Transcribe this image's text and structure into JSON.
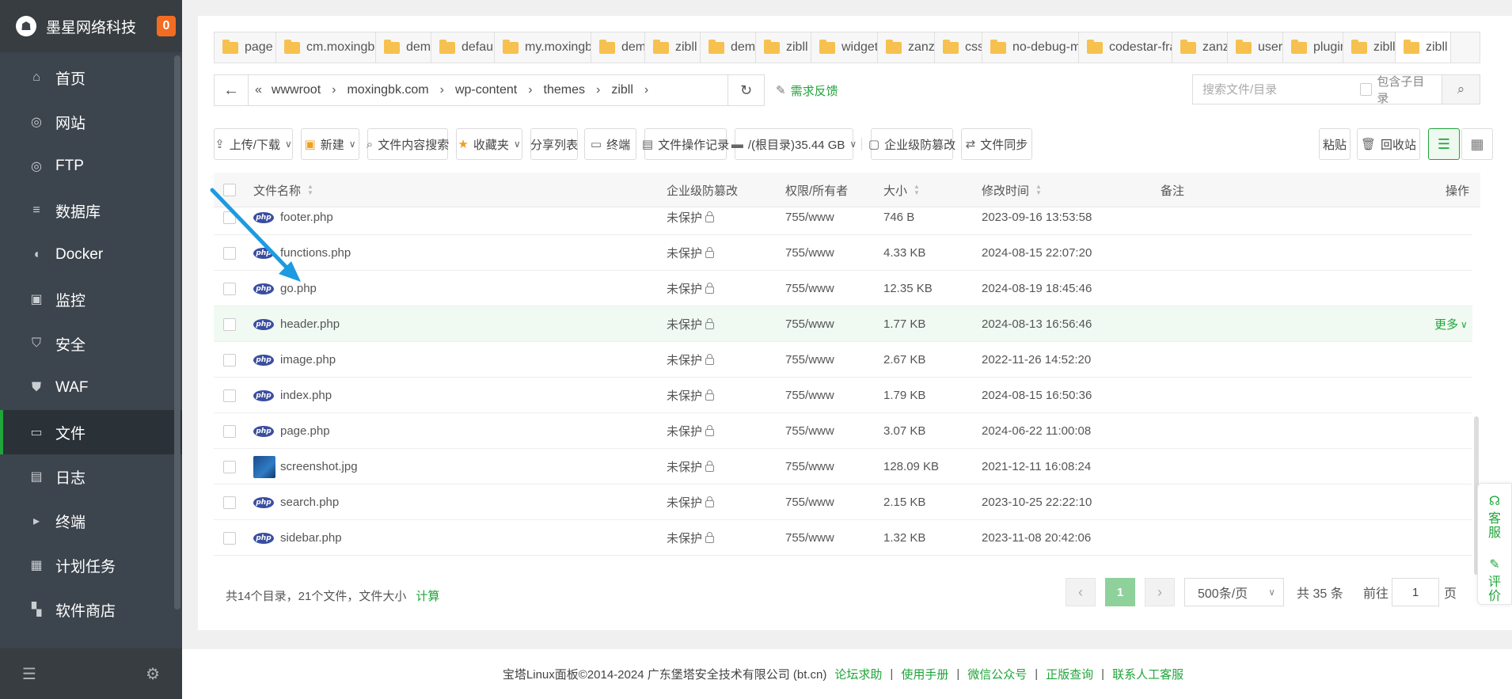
{
  "sidebar": {
    "title": "墨星网络科技",
    "badge": "0",
    "items": [
      {
        "label": "首页",
        "icon": "home-icon"
      },
      {
        "label": "网站",
        "icon": "globe-icon"
      },
      {
        "label": "FTP",
        "icon": "ftp-icon"
      },
      {
        "label": "数据库",
        "icon": "database-icon"
      },
      {
        "label": "Docker",
        "icon": "docker-icon"
      },
      {
        "label": "监控",
        "icon": "monitor-icon"
      },
      {
        "label": "安全",
        "icon": "shield-icon"
      },
      {
        "label": "WAF",
        "icon": "waf-icon"
      },
      {
        "label": "文件",
        "icon": "folder-icon"
      },
      {
        "label": "日志",
        "icon": "log-icon"
      },
      {
        "label": "终端",
        "icon": "terminal-icon"
      },
      {
        "label": "计划任务",
        "icon": "calendar-icon"
      },
      {
        "label": "软件商店",
        "icon": "apps-icon"
      }
    ],
    "active_item": "文件"
  },
  "tabs": [
    "page",
    "cm.moxingbk",
    "demo",
    "default",
    "my.moxingbk",
    "demo",
    "zibll",
    "demo",
    "zibll",
    "widget",
    "zanzhu",
    "css",
    "no-debug-m",
    "codestar-fra",
    "zanzh",
    "user",
    "plugin",
    "zibll",
    "zibll"
  ],
  "breadcrumb": [
    "wwwroot",
    "moxingbk.com",
    "wp-content",
    "themes",
    "zibll"
  ],
  "feedback_label": "需求反馈",
  "search": {
    "placeholder": "搜索文件/目录",
    "subdir_label": "包含子目录"
  },
  "toolbar": {
    "upload": "上传/下载",
    "new": "新建",
    "content_search": "文件内容搜索",
    "favorites": "收藏夹",
    "share_list": "分享列表",
    "terminal": "终端",
    "op_log": "文件操作记录",
    "disk": "/(根目录)35.44 GB",
    "tamper": "企业级防篡改",
    "sync": "文件同步",
    "paste": "粘贴",
    "recycle": "回收站"
  },
  "table": {
    "headers": {
      "name": "文件名称",
      "tamper": "企业级防篡改",
      "perm": "权限/所有者",
      "size": "大小",
      "mtime": "修改时间",
      "note": "备注",
      "ops": "操作"
    },
    "rows": [
      {
        "name": "footer.php",
        "type": "php",
        "tamper": "未保护",
        "perm": "755/www",
        "size": "746 B",
        "mtime": "2023-09-16 13:53:58",
        "ops": ""
      },
      {
        "name": "functions.php",
        "type": "php",
        "tamper": "未保护",
        "perm": "755/www",
        "size": "4.33 KB",
        "mtime": "2024-08-15 22:07:20",
        "ops": ""
      },
      {
        "name": "go.php",
        "type": "php",
        "tamper": "未保护",
        "perm": "755/www",
        "size": "12.35 KB",
        "mtime": "2024-08-19 18:45:46",
        "ops": ""
      },
      {
        "name": "header.php",
        "type": "php",
        "tamper": "未保护",
        "perm": "755/www",
        "size": "1.77 KB",
        "mtime": "2024-08-13 16:56:46",
        "ops": "更多"
      },
      {
        "name": "image.php",
        "type": "php",
        "tamper": "未保护",
        "perm": "755/www",
        "size": "2.67 KB",
        "mtime": "2022-11-26 14:52:20",
        "ops": ""
      },
      {
        "name": "index.php",
        "type": "php",
        "tamper": "未保护",
        "perm": "755/www",
        "size": "1.79 KB",
        "mtime": "2024-08-15 16:50:36",
        "ops": ""
      },
      {
        "name": "page.php",
        "type": "php",
        "tamper": "未保护",
        "perm": "755/www",
        "size": "3.07 KB",
        "mtime": "2024-06-22 11:00:08",
        "ops": ""
      },
      {
        "name": "screenshot.jpg",
        "type": "jpg",
        "tamper": "未保护",
        "perm": "755/www",
        "size": "128.09 KB",
        "mtime": "2021-12-11 16:08:24",
        "ops": ""
      },
      {
        "name": "search.php",
        "type": "php",
        "tamper": "未保护",
        "perm": "755/www",
        "size": "2.15 KB",
        "mtime": "2023-10-25 22:22:10",
        "ops": ""
      },
      {
        "name": "sidebar.php",
        "type": "php",
        "tamper": "未保护",
        "perm": "755/www",
        "size": "1.32 KB",
        "mtime": "2023-11-08 20:42:06",
        "ops": ""
      }
    ],
    "highlighted_row": "header.php"
  },
  "php_badge": "php",
  "summary": {
    "text": "共14个目录，21个文件，文件大小",
    "calc": "计算"
  },
  "pager": {
    "current": "1",
    "page_size": "500条/页",
    "total": "共 35 条",
    "goto_prefix": "前往",
    "goto_value": "1",
    "goto_suffix": "页"
  },
  "float_help": {
    "service": "客\n服",
    "rate": "评\n价"
  },
  "footer": {
    "copyright": "宝塔Linux面板©2014-2024 广东堡塔安全技术有限公司 (bt.cn)",
    "links": [
      "论坛求助",
      "使用手册",
      "微信公众号",
      "正版查询",
      "联系人工客服"
    ]
  },
  "colors": {
    "accent": "#20a53a",
    "sidebar_bg": "#3c444d",
    "annotation_arrow": "#1d9be0",
    "badge": "#f26c22"
  }
}
